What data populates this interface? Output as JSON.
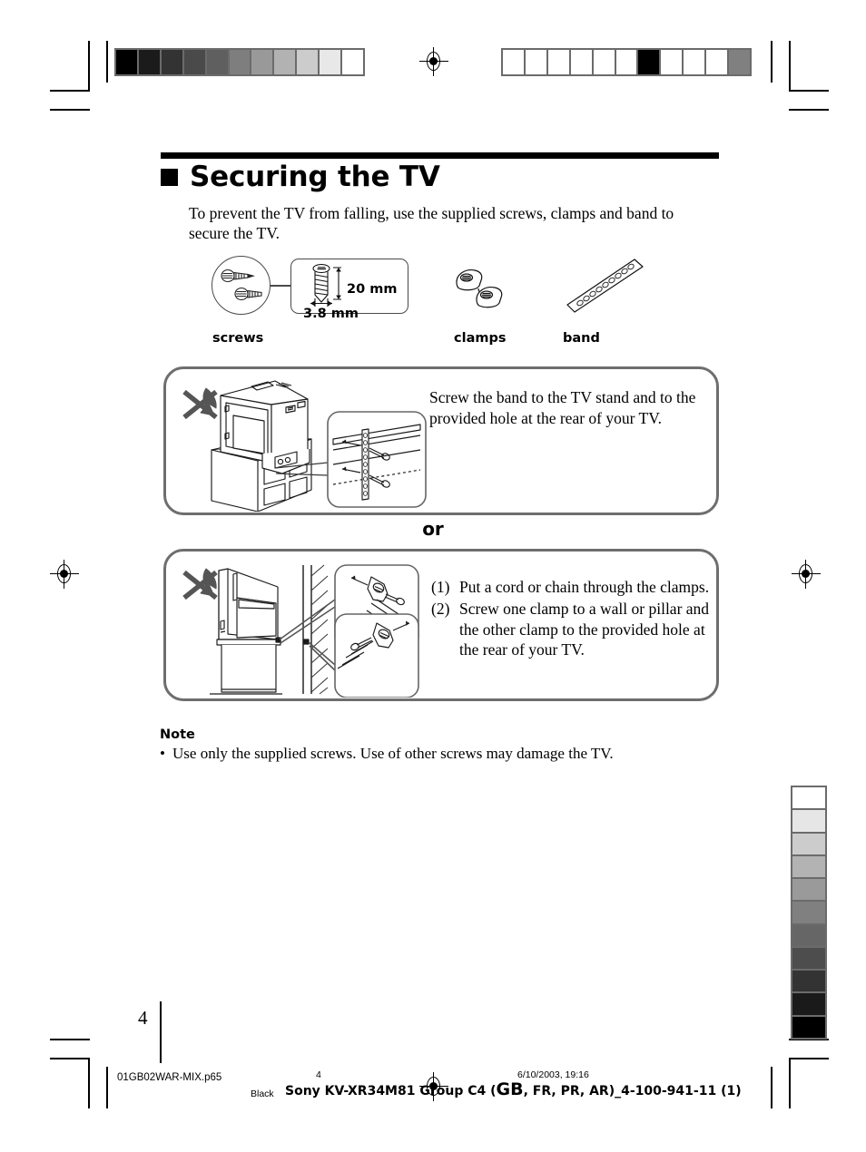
{
  "page": {
    "number": "4",
    "heading": "Securing the TV",
    "intro": "To prevent the TV from falling, use the supplied  screws, clamps and band to secure the TV."
  },
  "parts": {
    "screws_label": "screws",
    "clamps_label": "clamps",
    "band_label": "band",
    "screw_length": "20 mm",
    "screw_diameter": "3.8 mm"
  },
  "panels": {
    "first": {
      "text": "Screw the band to the TV stand and to the provided hole at the rear of your TV."
    },
    "separator": "or",
    "second": {
      "steps": [
        {
          "num": "(1)",
          "text": "Put a cord or chain through the clamps."
        },
        {
          "num": "(2)",
          "text": "Screw one clamp to a wall or pillar and the other clamp to the provided hole at the rear of your TV."
        }
      ]
    }
  },
  "note": {
    "heading": "Note",
    "bullet": "•",
    "text": "Use only the supplied screws.  Use of other screws may damage the TV."
  },
  "footer": {
    "filename": "01GB02WAR-MIX.p65",
    "plate": "Black",
    "page_number": "4",
    "timestamp": "6/10/2003, 19:16",
    "job_prefix": "Sony KV-XR34M81 Group C4 (",
    "job_gb": "GB",
    "job_suffix": ", FR, PR, AR)_4-100-941-11 (1)"
  },
  "calibration": {
    "top_left_swatches": [
      "#000000",
      "#1b1b1b",
      "#333333",
      "#4a4a4a",
      "#5f5f5f",
      "#7e7e7e",
      "#999999",
      "#b2b2b2",
      "#cccccc",
      "#e8e8e8",
      "#ffffff"
    ],
    "top_right_swatches": [
      "#ffffff",
      "#ffffff",
      "#ffffff",
      "#ffffff",
      "#ffffff",
      "#ffffff",
      "#000000",
      "#ffffff",
      "#ffffff",
      "#ffffff",
      "#808080"
    ],
    "right_vertical_swatches": [
      "#ffffff",
      "#e6e6e6",
      "#cccccc",
      "#b3b3b3",
      "#9a9a9a",
      "#808080",
      "#666666",
      "#4d4d4d",
      "#333333",
      "#1a1a1a",
      "#000000"
    ],
    "strip_frame_color": "#6b6b6b"
  }
}
